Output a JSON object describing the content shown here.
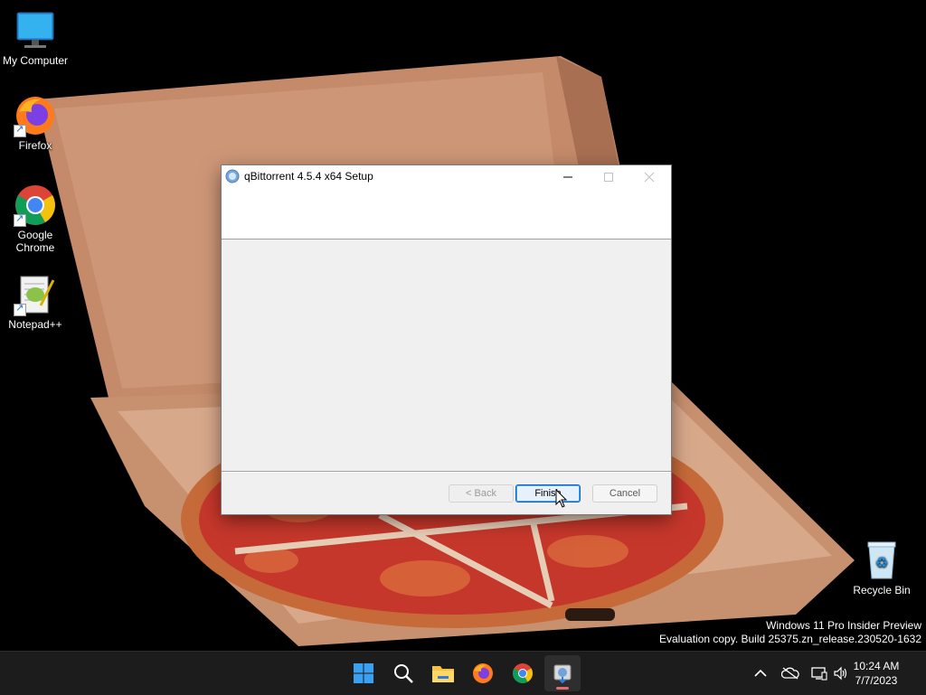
{
  "desktop": {
    "icons": [
      {
        "label": "My Computer",
        "icon": "monitor-icon"
      },
      {
        "label": "Firefox",
        "icon": "firefox-icon"
      },
      {
        "label": "Google Chrome",
        "icon": "chrome-icon"
      },
      {
        "label": "Notepad++",
        "icon": "notepadpp-icon"
      },
      {
        "label": "Recycle Bin",
        "icon": "recycle-bin-icon"
      }
    ],
    "watermark": {
      "line1": "Windows 11 Pro Insider Preview",
      "line2": "Evaluation copy. Build 25375.zn_release.230520-1632"
    }
  },
  "dialog": {
    "title": "qBittorrent 4.5.4 x64 Setup",
    "buttons": {
      "back": "< Back",
      "finish": "Finish",
      "cancel": "Cancel"
    }
  },
  "taskbar": {
    "apps": [
      "start-icon",
      "search-icon",
      "file-explorer-icon",
      "firefox-icon",
      "chrome-icon",
      "qbittorrent-setup-icon"
    ],
    "clock": {
      "time": "10:24 AM",
      "date": "7/7/2023"
    },
    "tray": [
      "chevron-up-icon",
      "cloud-offline-icon",
      "network-icon",
      "volume-icon"
    ]
  },
  "colors": {
    "accent": "#0067c0",
    "taskbar": "#1c1c1c",
    "box": "#c98c6b"
  }
}
